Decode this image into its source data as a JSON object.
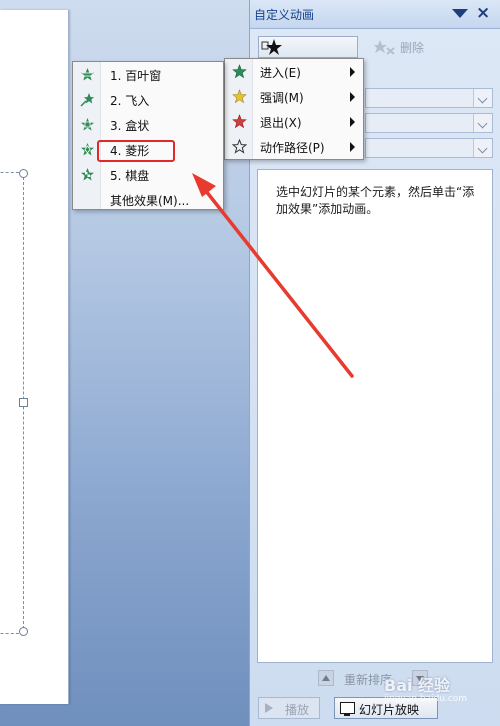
{
  "task_pane": {
    "title": "自定义动画",
    "add_effect_icon": "star-icon",
    "remove_label": "删除",
    "hint": "选中幻灯片的某个元素，然后单击“添加效果”添加动画。",
    "reorder_label": "重新排序",
    "play_label": "播放",
    "slideshow_label": "幻灯片放映"
  },
  "effect_menu": {
    "items": [
      {
        "label": "进入(E)",
        "icon": "green-star-icon",
        "color": "#2e8b57"
      },
      {
        "label": "强调(M)",
        "icon": "yellow-star-icon",
        "color": "#d4a017"
      },
      {
        "label": "退出(X)",
        "icon": "red-star-icon",
        "color": "#d23c3c"
      },
      {
        "label": "动作路径(P)",
        "icon": "outline-star-icon",
        "color": "#333333"
      }
    ]
  },
  "entrance_menu": {
    "items": [
      {
        "label": "1. 百叶窗",
        "icon": "blinds-effect-icon"
      },
      {
        "label": "2. 飞入",
        "icon": "fly-in-effect-icon"
      },
      {
        "label": "3. 盒状",
        "icon": "box-effect-icon"
      },
      {
        "label": "4. 菱形",
        "icon": "diamond-effect-icon",
        "highlighted": true
      },
      {
        "label": "5. 棋盘",
        "icon": "checkerboard-effect-icon"
      },
      {
        "label": "其他效果(M)...",
        "icon": ""
      }
    ]
  },
  "annotation": {
    "highlight_color": "#e02a2a",
    "arrow_color": "#e63b2e"
  },
  "watermark": {
    "text": "Bai 经验",
    "sub": "jingyan.baidu.com"
  }
}
